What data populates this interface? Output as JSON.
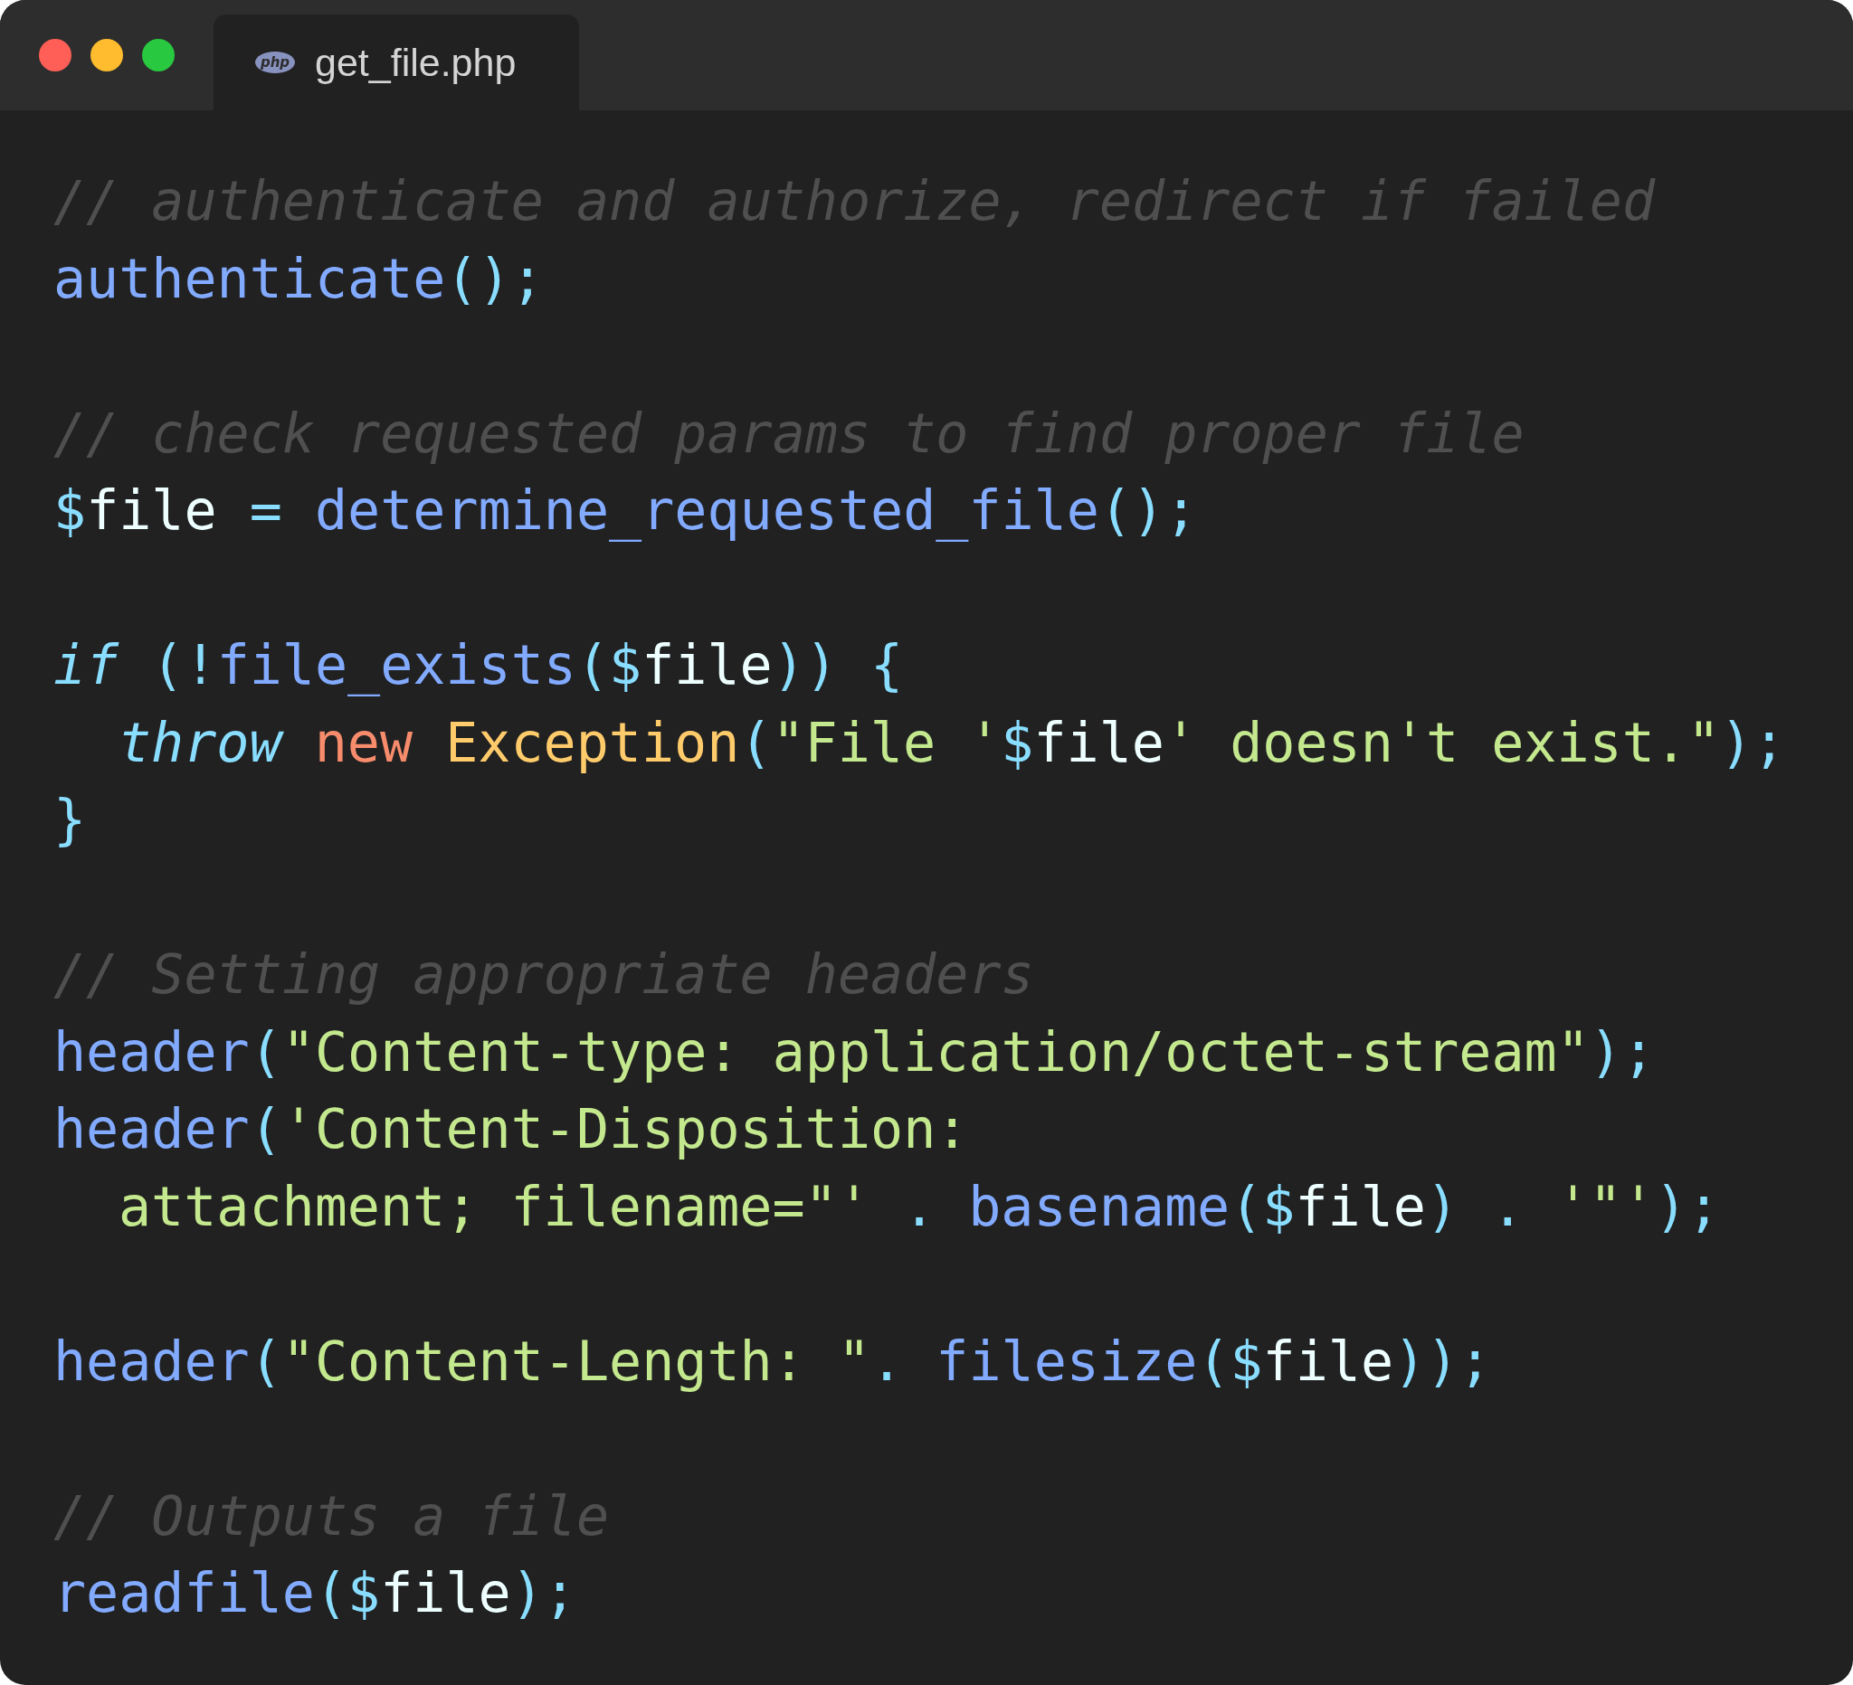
{
  "tab": {
    "icon_text": "php",
    "title": "get_file.php",
    "selected": true
  },
  "lines": [
    {
      "kind": "comment",
      "text": "// authenticate and authorize, redirect if failed"
    },
    {
      "kind": "code",
      "tokens": [
        {
          "kind": "fn",
          "text": "authenticate"
        },
        {
          "kind": "punct",
          "text": "();"
        }
      ]
    },
    {
      "kind": "blank"
    },
    {
      "kind": "comment",
      "text": "// check requested params to find proper file"
    },
    {
      "kind": "code",
      "tokens": [
        {
          "kind": "sigil",
          "text": "$"
        },
        {
          "kind": "plain",
          "text": "file "
        },
        {
          "kind": "punct",
          "text": "= "
        },
        {
          "kind": "fn",
          "text": "determine_requested_file"
        },
        {
          "kind": "punct",
          "text": "();"
        }
      ]
    },
    {
      "kind": "blank"
    },
    {
      "kind": "code",
      "tokens": [
        {
          "kind": "keyword",
          "text": "if"
        },
        {
          "kind": "punct",
          "text": " (!"
        },
        {
          "kind": "fn",
          "text": "file_exists"
        },
        {
          "kind": "punct",
          "text": "("
        },
        {
          "kind": "sigil",
          "text": "$"
        },
        {
          "kind": "plain",
          "text": "file"
        },
        {
          "kind": "punct",
          "text": ")) {"
        }
      ]
    },
    {
      "kind": "indented",
      "tokens": [
        {
          "kind": "keyword",
          "text": "throw"
        },
        {
          "kind": "new",
          "text": " new"
        },
        {
          "kind": "class",
          "text": " Exception"
        },
        {
          "kind": "punct",
          "text": "("
        },
        {
          "kind": "string",
          "text": "\"File '"
        },
        {
          "kind": "sigil",
          "text": "$"
        },
        {
          "kind": "plain",
          "text": "file"
        },
        {
          "kind": "string",
          "text": "' doesn't exist.\""
        },
        {
          "kind": "punct",
          "text": ");"
        }
      ]
    },
    {
      "kind": "code",
      "tokens": [
        {
          "kind": "punct",
          "text": "}"
        }
      ]
    },
    {
      "kind": "blank"
    },
    {
      "kind": "comment",
      "text": "// Setting appropriate headers"
    },
    {
      "kind": "code",
      "tokens": [
        {
          "kind": "fn",
          "text": "header"
        },
        {
          "kind": "punct",
          "text": "("
        },
        {
          "kind": "string",
          "text": "\"Content-type: application/octet-stream\""
        },
        {
          "kind": "punct",
          "text": ");"
        }
      ]
    },
    {
      "kind": "code",
      "tokens": [
        {
          "kind": "fn",
          "text": "header"
        },
        {
          "kind": "punct",
          "text": "("
        },
        {
          "kind": "string",
          "text": "'Content-Disposition:"
        }
      ]
    },
    {
      "kind": "indented",
      "tokens": [
        {
          "kind": "string",
          "text": "attachment; filename=\"' "
        },
        {
          "kind": "punct",
          "text": ". "
        },
        {
          "kind": "fn",
          "text": "basename"
        },
        {
          "kind": "punct",
          "text": "("
        },
        {
          "kind": "sigil",
          "text": "$"
        },
        {
          "kind": "plain",
          "text": "file"
        },
        {
          "kind": "punct",
          "text": ") . "
        },
        {
          "kind": "string",
          "text": "'\"'"
        },
        {
          "kind": "punct",
          "text": ");"
        }
      ]
    },
    {
      "kind": "blank"
    },
    {
      "kind": "code",
      "tokens": [
        {
          "kind": "fn",
          "text": "header"
        },
        {
          "kind": "punct",
          "text": "("
        },
        {
          "kind": "string",
          "text": "\"Content-Length: \""
        },
        {
          "kind": "punct",
          "text": ". "
        },
        {
          "kind": "fn",
          "text": "filesize"
        },
        {
          "kind": "punct",
          "text": "("
        },
        {
          "kind": "sigil",
          "text": "$"
        },
        {
          "kind": "plain",
          "text": "file"
        },
        {
          "kind": "punct",
          "text": "));"
        }
      ]
    },
    {
      "kind": "blank"
    },
    {
      "kind": "comment",
      "text": "// Outputs a file"
    },
    {
      "kind": "code",
      "tokens": [
        {
          "kind": "fn",
          "text": "readfile"
        },
        {
          "kind": "punct",
          "text": "("
        },
        {
          "kind": "sigil",
          "text": "$"
        },
        {
          "kind": "plain",
          "text": "file"
        },
        {
          "kind": "punct",
          "text": ");"
        }
      ]
    }
  ]
}
